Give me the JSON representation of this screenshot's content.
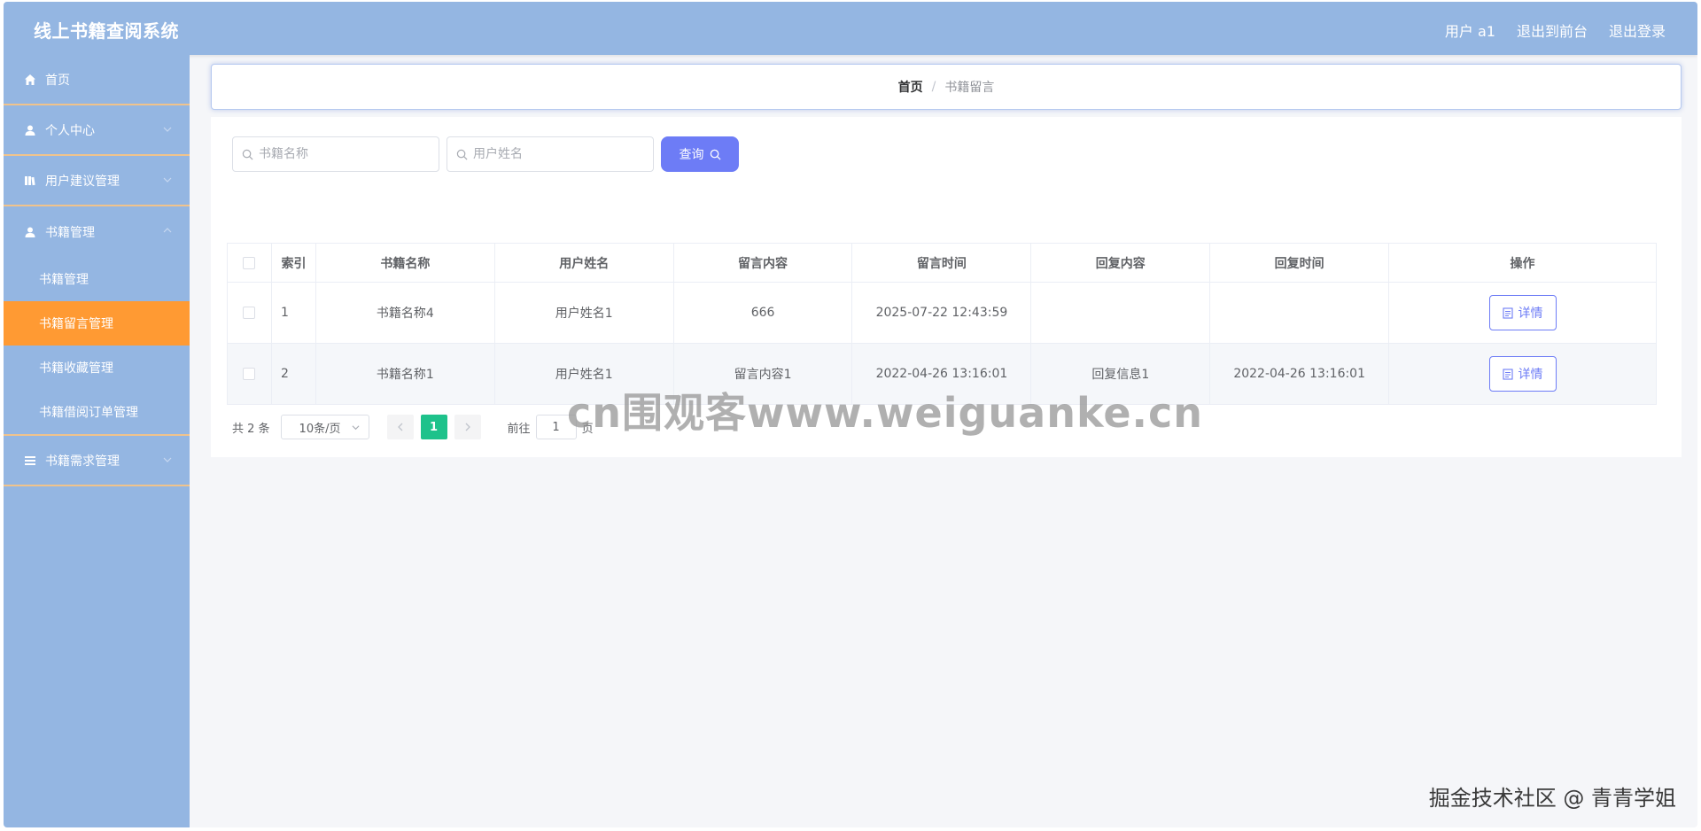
{
  "header": {
    "title": "线上书籍查阅系统",
    "user_label": "用户 a1",
    "to_front_label": "退出到前台",
    "logout_label": "退出登录"
  },
  "sidebar": {
    "items": [
      {
        "label": "首页",
        "icon": "home-icon"
      },
      {
        "label": "个人中心",
        "icon": "user-icon"
      },
      {
        "label": "用户建议管理",
        "icon": "book-icon"
      },
      {
        "label": "书籍管理",
        "icon": "user-icon",
        "expanded": true,
        "children": [
          {
            "label": "书籍管理"
          },
          {
            "label": "书籍留言管理",
            "active": true
          },
          {
            "label": "书籍收藏管理"
          },
          {
            "label": "书籍借阅订单管理"
          }
        ]
      },
      {
        "label": "书籍需求管理",
        "icon": "list-icon"
      }
    ]
  },
  "breadcrumb": {
    "home": "首页",
    "separator": "/",
    "current": "书籍留言"
  },
  "search": {
    "book_placeholder": "书籍名称",
    "user_placeholder": "用户姓名",
    "button_label": "查询"
  },
  "table": {
    "headers": [
      "索引",
      "书籍名称",
      "用户姓名",
      "留言内容",
      "留言时间",
      "回复内容",
      "回复时间",
      "操作"
    ],
    "rows": [
      {
        "index": "1",
        "book": "书籍名称4",
        "user": "用户姓名1",
        "content": "666",
        "time": "2025-07-22 12:43:59",
        "reply": "",
        "reply_time": "",
        "action": "详情"
      },
      {
        "index": "2",
        "book": "书籍名称1",
        "user": "用户姓名1",
        "content": "留言内容1",
        "time": "2022-04-26 13:16:01",
        "reply": "回复信息1",
        "reply_time": "2022-04-26 13:16:01",
        "action": "详情"
      }
    ]
  },
  "pagination": {
    "total": "共 2 条",
    "page_size": "10条/页",
    "current_page": "1",
    "goto_prefix": "前往",
    "goto_value": "1",
    "goto_suffix": "页"
  },
  "watermark": "cn围观客www.weiguanke.cn",
  "credit": "掘金技术社区 @ 青青学姐",
  "colors": {
    "header_bg": "#94b6e2",
    "sidebar_bg": "#94b6e2",
    "active_menu": "#ff9a33",
    "primary_button": "#6d7cf6",
    "current_page": "#1ec28b"
  }
}
